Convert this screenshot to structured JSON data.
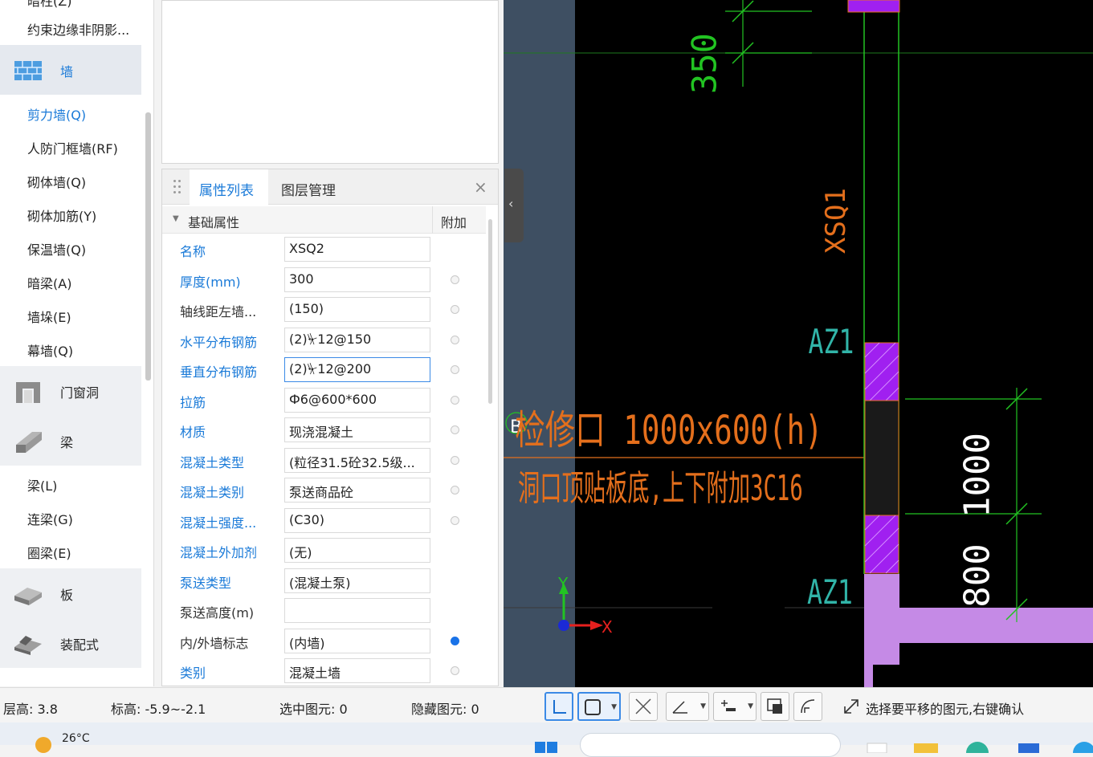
{
  "tree": {
    "top_partial": "暗柱(Z)",
    "items_top": [
      "约束边缘非阴影..."
    ],
    "cat_wall": "墙",
    "wall_items": [
      "剪力墙(Q)",
      "人防门框墙(RF)",
      "砌体墙(Q)",
      "砌体加筋(Y)",
      "保温墙(Q)",
      "暗梁(A)",
      "墙垛(E)",
      "幕墙(Q)"
    ],
    "cat_door": "门窗洞",
    "cat_beam": "梁",
    "beam_items": [
      "梁(L)",
      "连梁(G)",
      "圈梁(E)"
    ],
    "cat_slab": "板",
    "cat_prefab": "装配式"
  },
  "props": {
    "tab_attr": "属性列表",
    "tab_layer": "图层管理",
    "close": "×",
    "group_title": "基础属性",
    "group_extra": "附加",
    "rows": [
      {
        "name": "名称",
        "value": "XSQ2",
        "color": "blue",
        "dot": "none"
      },
      {
        "name": "厚度(mm)",
        "value": "300",
        "color": "blue",
        "dot": "off"
      },
      {
        "name": "轴线距左墙...",
        "value": "(150)",
        "color": "black",
        "dot": "off"
      },
      {
        "name": "水平分布钢筋",
        "value": "(2)⏧12@150",
        "color": "blue",
        "dot": "off"
      },
      {
        "name": "垂直分布钢筋",
        "value": "(2)⏧12@200",
        "color": "blue",
        "dot": "off"
      },
      {
        "name": "拉筋",
        "value": "Ф6@600*600",
        "color": "blue",
        "dot": "off"
      },
      {
        "name": "材质",
        "value": "现浇混凝土",
        "color": "blue",
        "dot": "off"
      },
      {
        "name": "混凝土类型",
        "value": "(粒径31.5砼32.5级...",
        "color": "blue",
        "dot": "off"
      },
      {
        "name": "混凝土类别",
        "value": "泵送商品砼",
        "color": "blue",
        "dot": "off"
      },
      {
        "name": "混凝土强度...",
        "value": "(C30)",
        "color": "blue",
        "dot": "off"
      },
      {
        "name": "混凝土外加剂",
        "value": "(无)",
        "color": "blue",
        "dot": "none"
      },
      {
        "name": "泵送类型",
        "value": "(混凝土泵)",
        "color": "blue",
        "dot": "none"
      },
      {
        "name": "泵送高度(m)",
        "value": "",
        "color": "black",
        "dot": "none"
      },
      {
        "name": "内/外墙标志",
        "value": "(内墙)",
        "color": "black",
        "dot": "on"
      },
      {
        "name": "类别",
        "value": "混凝土墙",
        "color": "blue",
        "dot": "off"
      }
    ]
  },
  "cad": {
    "dim_350": "350",
    "label_xsq1": "XSQ1",
    "label_az1_top": "AZ1",
    "label_az1_bottom": "AZ1",
    "label_b": "B",
    "opening_title": "检修口 1000x600(h)",
    "opening_note": "洞口顶贴板底,上下附加3C16",
    "dim_1000": "1000",
    "dim_800": "800",
    "axis_y": "Y",
    "axis_x": "X",
    "colors": {
      "green": "#22c322",
      "orange": "#e46f1c",
      "purple": "#a020f0",
      "pink": "#c58ae6",
      "cyan_text": "#31b4a8",
      "side": "#3e4f62"
    }
  },
  "status": {
    "floor": "层高:  3.8",
    "elevation": "标高:  -5.9~-2.1",
    "selected": "选中图元:  0",
    "hidden": "隐藏图元:  0",
    "hint": "选择要平移的图元,右键确认"
  },
  "taskbar": {
    "temp": "26°C"
  }
}
